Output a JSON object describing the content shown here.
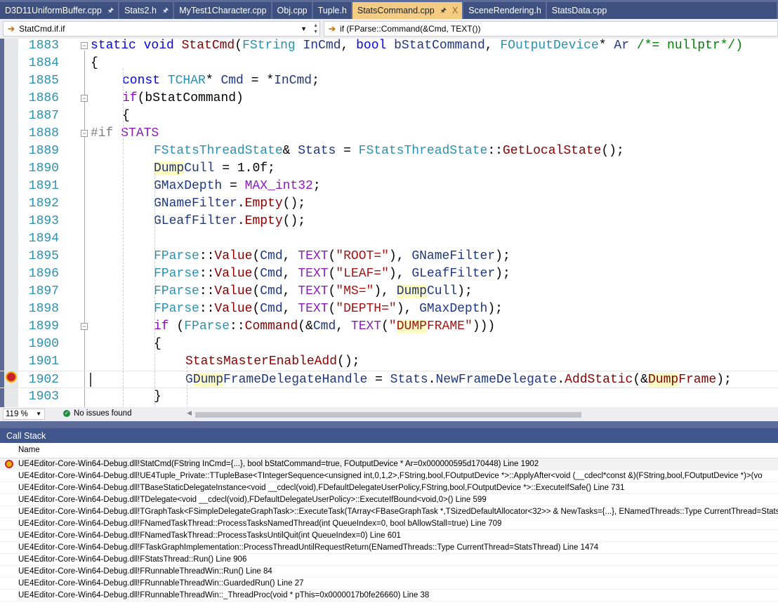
{
  "tabs": [
    {
      "label": "D3D11UniformBuffer.cpp",
      "pinned": true
    },
    {
      "label": "Stats2.h",
      "pinned": true
    },
    {
      "label": "MyTest1Character.cpp"
    },
    {
      "label": "Obj.cpp"
    },
    {
      "label": "Tuple.h"
    },
    {
      "label": "StatsCommand.cpp",
      "pinned": true,
      "active": true,
      "close": "X"
    },
    {
      "label": "SceneRendering.h"
    },
    {
      "label": "StatsData.cpp"
    }
  ],
  "nav": {
    "scope": "StatCmd.if.if",
    "member": "if (FParse::Command(&Cmd, TEXT())"
  },
  "code": [
    {
      "n": "1883",
      "i": 0,
      "fold": true,
      "t": [
        [
          "static void ",
          "kw"
        ],
        [
          "StatCmd",
          "fn"
        ],
        [
          "(",
          "tx"
        ],
        [
          "FString ",
          "ty"
        ],
        [
          "InCmd",
          "pa"
        ],
        [
          ", ",
          "tx"
        ],
        [
          "bool ",
          "kw"
        ],
        [
          "bStatCommand",
          "pa"
        ],
        [
          ", ",
          "tx"
        ],
        [
          "FOutputDevice",
          "ty"
        ],
        [
          "* ",
          "tx"
        ],
        [
          "Ar ",
          "pa"
        ],
        [
          "/*= nullptr*/)",
          "cm"
        ]
      ]
    },
    {
      "n": "1884",
      "i": 0,
      "t": [
        [
          "{",
          "tx"
        ]
      ]
    },
    {
      "n": "1885",
      "i": 1,
      "t": [
        [
          "const ",
          "kw"
        ],
        [
          "TCHAR",
          "ty"
        ],
        [
          "* ",
          "tx"
        ],
        [
          "Cmd",
          "mb"
        ],
        [
          " = *",
          "tx"
        ],
        [
          "InCmd",
          "pa"
        ],
        [
          ";",
          "tx"
        ]
      ]
    },
    {
      "n": "1886",
      "i": 1,
      "fold": true,
      "t": [
        [
          "if",
          "ct"
        ],
        [
          "(bStatCommand)",
          "tx"
        ]
      ]
    },
    {
      "n": "1887",
      "i": 1,
      "t": [
        [
          "{",
          "tx"
        ]
      ]
    },
    {
      "n": "1888",
      "i": 0,
      "fold": true,
      "t": [
        [
          "#if ",
          "pp"
        ],
        [
          "STATS",
          "mc"
        ]
      ]
    },
    {
      "n": "1889",
      "i": 2,
      "t": [
        [
          "FStatsThreadState",
          "ty"
        ],
        [
          "& ",
          "tx"
        ],
        [
          "Stats",
          "mb"
        ],
        [
          " = ",
          "tx"
        ],
        [
          "FStatsThreadState",
          "ty"
        ],
        [
          "::",
          "tx"
        ],
        [
          "GetLocalState",
          "fn"
        ],
        [
          "();",
          "tx"
        ]
      ]
    },
    {
      "n": "1890",
      "i": 2,
      "t": [
        [
          "Dump",
          "hl mb"
        ],
        [
          "Cull",
          "mb"
        ],
        [
          " = 1.0f;",
          "tx"
        ]
      ]
    },
    {
      "n": "1891",
      "i": 2,
      "t": [
        [
          "GMaxDepth",
          "mb"
        ],
        [
          " = ",
          "tx"
        ],
        [
          "MAX_int32",
          "mc"
        ],
        [
          ";",
          "tx"
        ]
      ]
    },
    {
      "n": "1892",
      "i": 2,
      "t": [
        [
          "GNameFilter",
          "mb"
        ],
        [
          ".",
          "tx"
        ],
        [
          "Empty",
          "fn"
        ],
        [
          "();",
          "tx"
        ]
      ]
    },
    {
      "n": "1893",
      "i": 2,
      "t": [
        [
          "GLeafFilter",
          "mb"
        ],
        [
          ".",
          "tx"
        ],
        [
          "Empty",
          "fn"
        ],
        [
          "();",
          "tx"
        ]
      ]
    },
    {
      "n": "1894",
      "i": 2,
      "t": []
    },
    {
      "n": "1895",
      "i": 2,
      "t": [
        [
          "FParse",
          "ty"
        ],
        [
          "::",
          "tx"
        ],
        [
          "Value",
          "fn"
        ],
        [
          "(",
          "tx"
        ],
        [
          "Cmd",
          "mb"
        ],
        [
          ", ",
          "tx"
        ],
        [
          "TEXT",
          "mc"
        ],
        [
          "(",
          "tx"
        ],
        [
          "\"ROOT=\"",
          "st"
        ],
        [
          "), ",
          "tx"
        ],
        [
          "GNameFilter",
          "mb"
        ],
        [
          ");",
          "tx"
        ]
      ]
    },
    {
      "n": "1896",
      "i": 2,
      "t": [
        [
          "FParse",
          "ty"
        ],
        [
          "::",
          "tx"
        ],
        [
          "Value",
          "fn"
        ],
        [
          "(",
          "tx"
        ],
        [
          "Cmd",
          "mb"
        ],
        [
          ", ",
          "tx"
        ],
        [
          "TEXT",
          "mc"
        ],
        [
          "(",
          "tx"
        ],
        [
          "\"LEAF=\"",
          "st"
        ],
        [
          "), ",
          "tx"
        ],
        [
          "GLeafFilter",
          "mb"
        ],
        [
          ");",
          "tx"
        ]
      ]
    },
    {
      "n": "1897",
      "i": 2,
      "t": [
        [
          "FParse",
          "ty"
        ],
        [
          "::",
          "tx"
        ],
        [
          "Value",
          "fn"
        ],
        [
          "(",
          "tx"
        ],
        [
          "Cmd",
          "mb"
        ],
        [
          ", ",
          "tx"
        ],
        [
          "TEXT",
          "mc"
        ],
        [
          "(",
          "tx"
        ],
        [
          "\"MS=\"",
          "st"
        ],
        [
          "), ",
          "tx"
        ],
        [
          "Dump",
          "hl mb"
        ],
        [
          "Cull",
          "mb"
        ],
        [
          ");",
          "tx"
        ]
      ]
    },
    {
      "n": "1898",
      "i": 2,
      "t": [
        [
          "FParse",
          "ty"
        ],
        [
          "::",
          "tx"
        ],
        [
          "Value",
          "fn"
        ],
        [
          "(",
          "tx"
        ],
        [
          "Cmd",
          "mb"
        ],
        [
          ", ",
          "tx"
        ],
        [
          "TEXT",
          "mc"
        ],
        [
          "(",
          "tx"
        ],
        [
          "\"DEPTH=\"",
          "st"
        ],
        [
          "), ",
          "tx"
        ],
        [
          "GMaxDepth",
          "mb"
        ],
        [
          ");",
          "tx"
        ]
      ]
    },
    {
      "n": "1899",
      "i": 2,
      "fold": true,
      "t": [
        [
          "if ",
          "ct"
        ],
        [
          "(",
          "tx"
        ],
        [
          "FParse",
          "ty"
        ],
        [
          "::",
          "tx"
        ],
        [
          "Command",
          "fn"
        ],
        [
          "(&",
          "tx"
        ],
        [
          "Cmd",
          "mb"
        ],
        [
          ", ",
          "tx"
        ],
        [
          "TEXT",
          "mc"
        ],
        [
          "(",
          "tx"
        ],
        [
          "\"",
          "st"
        ],
        [
          "DUMP",
          "hl st"
        ],
        [
          "FRAME\"",
          "st"
        ],
        [
          ")))",
          "tx"
        ]
      ]
    },
    {
      "n": "1900",
      "i": 2,
      "t": [
        [
          "{",
          "tx"
        ]
      ]
    },
    {
      "n": "1901",
      "i": 3,
      "t": [
        [
          "StatsMasterEnableAdd",
          "fn"
        ],
        [
          "();",
          "tx"
        ]
      ]
    },
    {
      "n": "1902",
      "i": 3,
      "current": true,
      "t": [
        [
          "G",
          "mb"
        ],
        [
          "Dump",
          "hl mb"
        ],
        [
          "FrameDelegateHandle",
          "mb"
        ],
        [
          " = ",
          "tx"
        ],
        [
          "Stats",
          "mb"
        ],
        [
          ".",
          "tx"
        ],
        [
          "NewFrameDelegate",
          "mb"
        ],
        [
          ".",
          "tx"
        ],
        [
          "AddStatic",
          "fn"
        ],
        [
          "(&",
          "tx"
        ],
        [
          "Dump",
          "hl fn"
        ],
        [
          "Frame",
          "fn"
        ],
        [
          ");",
          "tx"
        ]
      ]
    },
    {
      "n": "1903",
      "i": 2,
      "t": [
        [
          "}",
          "tx"
        ]
      ]
    }
  ],
  "status": {
    "zoom": "119 %",
    "issues": "No issues found"
  },
  "callstack": {
    "title": "Call Stack",
    "column": "Name",
    "rows": [
      "UE4Editor-Core-Win64-Debug.dll!StatCmd(FString InCmd={...}, bool bStatCommand=true, FOutputDevice * Ar=0x000000595d170448) Line 1902",
      "UE4Editor-Core-Win64-Debug.dll!UE4Tuple_Private::TTupleBase<TIntegerSequence<unsigned int,0,1,2>,FString,bool,FOutputDevice *>::ApplyAfter<void (__cdecl*const &)(FString,bool,FOutputDevice *)>(vo",
      "UE4Editor-Core-Win64-Debug.dll!TBaseStaticDelegateInstance<void __cdecl(void),FDefaultDelegateUserPolicy,FString,bool,FOutputDevice *>::ExecuteIfSafe() Line 731",
      "UE4Editor-Core-Win64-Debug.dll!TDelegate<void __cdecl(void),FDefaultDelegateUserPolicy>::ExecuteIfBound<void,0>() Line 599",
      "UE4Editor-Core-Win64-Debug.dll!TGraphTask<FSimpleDelegateGraphTask>::ExecuteTask(TArray<FBaseGraphTask *,TSizedDefaultAllocator<32>> & NewTasks={...}, ENamedThreads::Type CurrentThread=Stats",
      "UE4Editor-Core-Win64-Debug.dll!FNamedTaskThread::ProcessTasksNamedThread(int QueueIndex=0, bool bAllowStall=true) Line 709",
      "UE4Editor-Core-Win64-Debug.dll!FNamedTaskThread::ProcessTasksUntilQuit(int QueueIndex=0) Line 601",
      "UE4Editor-Core-Win64-Debug.dll!FTaskGraphImplementation::ProcessThreadUntilRequestReturn(ENamedThreads::Type CurrentThread=StatsThread) Line 1474",
      "UE4Editor-Core-Win64-Debug.dll!FStatsThread::Run() Line 906",
      "UE4Editor-Core-Win64-Debug.dll!FRunnableThreadWin::Run() Line 84",
      "UE4Editor-Core-Win64-Debug.dll!FRunnableThreadWin::GuardedRun() Line 27",
      "UE4Editor-Core-Win64-Debug.dll!FRunnableThreadWin::_ThreadProc(void * pThis=0x0000017b0fe26660) Line 38"
    ]
  },
  "colors": {
    "active_tab": "#f5cc84",
    "tab": "#3e5080",
    "chrome": "#5d6b99",
    "toolwindow_header": "#40568d"
  }
}
